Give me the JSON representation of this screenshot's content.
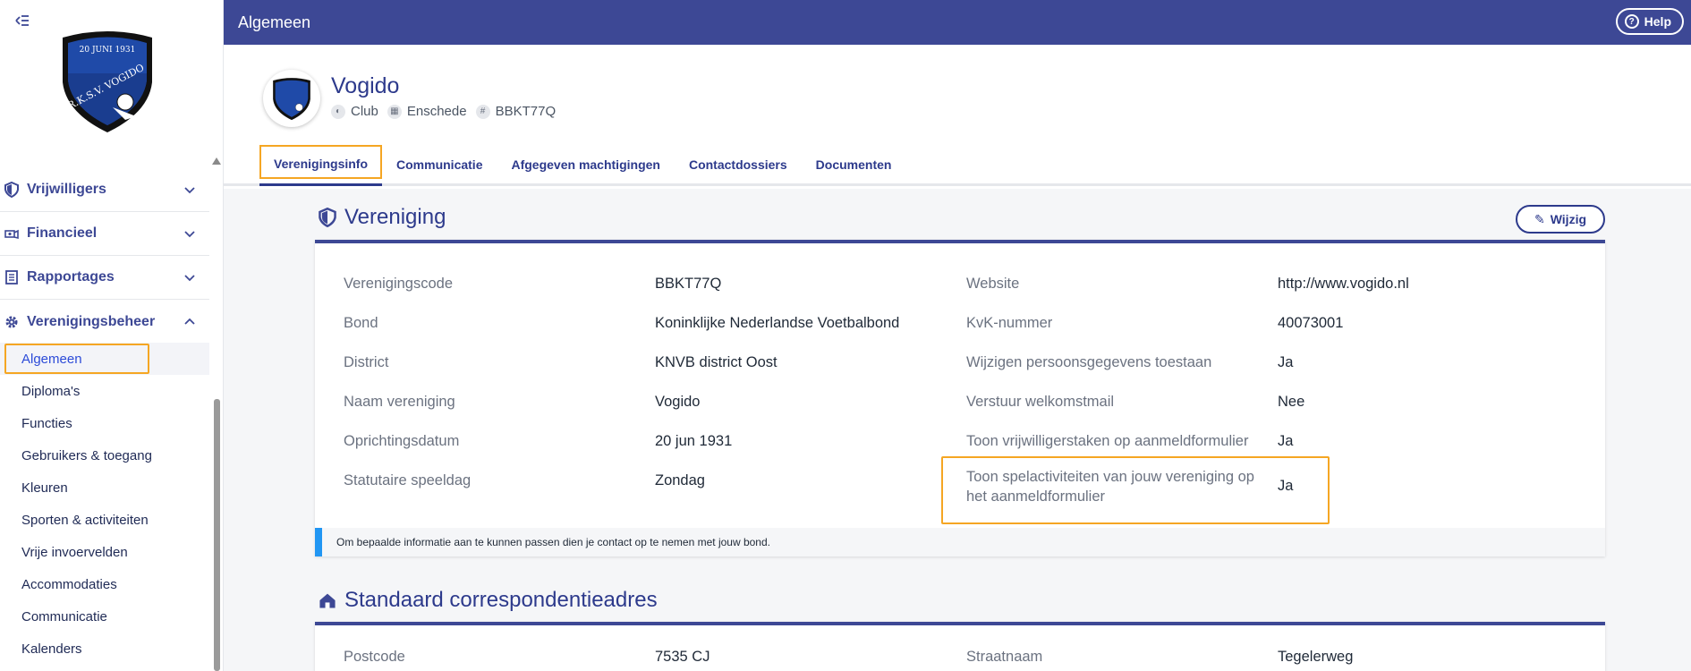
{
  "topbar": {
    "title": "Algemeen",
    "help_label": "Help"
  },
  "sidebar": {
    "logo_text_top": "20 JUNI 1931",
    "logo_text_bottom": "R.K.S.V. VOGIDO",
    "sections": [
      {
        "label": "Vrijwilligers",
        "icon": "shield-icon"
      },
      {
        "label": "Financieel",
        "icon": "money-icon"
      },
      {
        "label": "Rapportages",
        "icon": "report-icon"
      },
      {
        "label": "Verenigingsbeheer",
        "icon": "gear-icon"
      }
    ],
    "sub_items": [
      "Algemeen",
      "Diploma's",
      "Functies",
      "Gebruikers & toegang",
      "Kleuren",
      "Sporten & activiteiten",
      "Vrije invoervelden",
      "Accommodaties",
      "Communicatie",
      "Kalenders"
    ]
  },
  "header": {
    "club_name": "Vogido",
    "meta": [
      "Club",
      "Enschede",
      "BBKT77Q"
    ],
    "tabs": [
      "Verenigingsinfo",
      "Communicatie",
      "Afgegeven machtigingen",
      "Contactdossiers",
      "Documenten"
    ]
  },
  "vereniging": {
    "title": "Vereniging",
    "edit_label": "Wijzig",
    "left": [
      {
        "label": "Verenigingscode",
        "value": "BBKT77Q"
      },
      {
        "label": "Bond",
        "value": "Koninklijke Nederlandse Voetbalbond"
      },
      {
        "label": "District",
        "value": "KNVB district Oost"
      },
      {
        "label": "Naam vereniging",
        "value": "Vogido"
      },
      {
        "label": "Oprichtingsdatum",
        "value": "20 jun 1931"
      },
      {
        "label": "Statutaire speeldag",
        "value": "Zondag"
      }
    ],
    "right": [
      {
        "label": "Website",
        "value": "http://www.vogido.nl"
      },
      {
        "label": "KvK-nummer",
        "value": "40073001"
      },
      {
        "label": "Wijzigen persoonsgegevens toestaan",
        "value": "Ja"
      },
      {
        "label": "Verstuur welkomstmail",
        "value": "Nee"
      },
      {
        "label": "Toon vrijwilligerstaken op aanmeldformulier",
        "value": "Ja"
      },
      {
        "label": "Toon spelactiviteiten van jouw vereniging op het aanmeldformulier",
        "value": "Ja"
      }
    ],
    "note": "Om bepaalde informatie aan te kunnen passen dien je contact op te nemen met jouw bond."
  },
  "correspondentie": {
    "title": "Standaard correspondentieadres",
    "left": {
      "label": "Postcode",
      "value": "7535 CJ"
    },
    "right": {
      "label": "Straatnaam",
      "value": "Tegelerweg"
    }
  },
  "colors": {
    "primary": "#3d4895",
    "highlight": "#f5a623",
    "info": "#2196f3"
  }
}
